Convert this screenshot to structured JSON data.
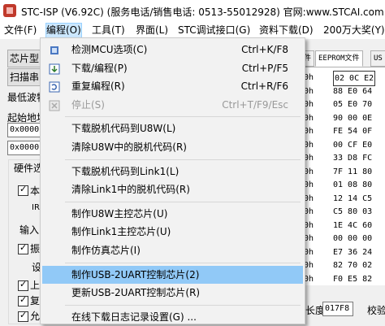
{
  "window": {
    "title": "STC-ISP (V6.92C) (服务电话/销售电话: 0513-55012928) 官网:www.STCAI.com"
  },
  "menubar": [
    {
      "label": "文件(F)",
      "active": false
    },
    {
      "label": "编程(O)",
      "active": true
    },
    {
      "label": "工具(T)",
      "active": false
    },
    {
      "label": "界面(L)",
      "active": false
    },
    {
      "label": "STC调试接口(G)",
      "active": false
    },
    {
      "label": "资料下载(D)",
      "active": false
    },
    {
      "label": "200万大奖(Y)",
      "active": false
    }
  ],
  "left_panel": {
    "chip_button": "芯片型",
    "scan_button": "扫描串",
    "min_baud_label": "最低波特",
    "start_addr_label": "起始地址",
    "addr_value_1": "0x0000",
    "addr_value_2": "0x0000",
    "hw_options_title": "硬件选",
    "options": [
      "本",
      "IR",
      "输入",
      "振",
      "设",
      "上",
      "复",
      "允"
    ]
  },
  "right_panel": {
    "tabs": [
      "件",
      "EEPROM文件",
      "US"
    ],
    "hex_rows": [
      {
        "addr": "0h",
        "data": "02 0C E2"
      },
      {
        "addr": "0h",
        "data": "88 E0 64"
      },
      {
        "addr": "0h",
        "data": "05 E0 70"
      },
      {
        "addr": "0h",
        "data": "90 00 0E"
      },
      {
        "addr": "0h",
        "data": "FE 54 0F"
      },
      {
        "addr": "0h",
        "data": "00 CF E0"
      },
      {
        "addr": "0h",
        "data": "33 D8 FC"
      },
      {
        "addr": "0h",
        "data": "7F 11 80"
      },
      {
        "addr": "0h",
        "data": "01 08 80"
      },
      {
        "addr": "0h",
        "data": "12 14 C5"
      },
      {
        "addr": "0h",
        "data": "C5 80 03"
      },
      {
        "addr": "0h",
        "data": "1E 4C 60"
      },
      {
        "addr": "0h",
        "data": "00 00 00"
      },
      {
        "addr": "0h",
        "data": "E7 36 24"
      },
      {
        "addr": "0h",
        "data": "82 70 02"
      },
      {
        "addr": "0h",
        "data": "F0 E5 82"
      }
    ],
    "length_label": "长度",
    "length_value": "017F8",
    "check_label": "校验"
  },
  "dropdown": {
    "items": [
      {
        "label": "检测MCU选项(C)",
        "shortcut": "Ctrl+K/F8",
        "icon": "chip-check-icon",
        "disabled": false,
        "highlighted": false
      },
      {
        "label": "下载/编程(P)",
        "shortcut": "Ctrl+P/F5",
        "icon": "download-program-icon",
        "disabled": false,
        "highlighted": false
      },
      {
        "label": "重复编程(R)",
        "shortcut": "Ctrl+R/F6",
        "icon": "repeat-program-icon",
        "disabled": false,
        "highlighted": false
      },
      {
        "label": "停止(S)",
        "shortcut": "Ctrl+T/F9/Esc",
        "icon": "stop-icon",
        "disabled": true,
        "highlighted": false
      },
      {
        "separator": true
      },
      {
        "label": "下载脱机代码到U8W(L)",
        "shortcut": "",
        "disabled": false,
        "highlighted": false
      },
      {
        "label": "清除U8W中的脱机代码(R)",
        "shortcut": "",
        "disabled": false,
        "highlighted": false
      },
      {
        "separator": true
      },
      {
        "label": "下载脱机代码到Link1(L)",
        "shortcut": "",
        "disabled": false,
        "highlighted": false
      },
      {
        "label": "清除Link1中的脱机代码(R)",
        "shortcut": "",
        "disabled": false,
        "highlighted": false
      },
      {
        "separator": true
      },
      {
        "label": "制作U8W主控芯片(U)",
        "shortcut": "",
        "disabled": false,
        "highlighted": false
      },
      {
        "label": "制作Link1主控芯片(U)",
        "shortcut": "",
        "disabled": false,
        "highlighted": false
      },
      {
        "label": "制作仿真芯片(I)",
        "shortcut": "",
        "disabled": false,
        "highlighted": false
      },
      {
        "separator": true
      },
      {
        "label": "制作USB-2UART控制芯片(2)",
        "shortcut": "",
        "disabled": false,
        "highlighted": true
      },
      {
        "label": "更新USB-2UART控制芯片(R)",
        "shortcut": "",
        "disabled": false,
        "highlighted": false
      },
      {
        "separator": true
      },
      {
        "label": "在线下载日志记录设置(G) ...",
        "shortcut": "",
        "disabled": false,
        "highlighted": false
      }
    ]
  }
}
